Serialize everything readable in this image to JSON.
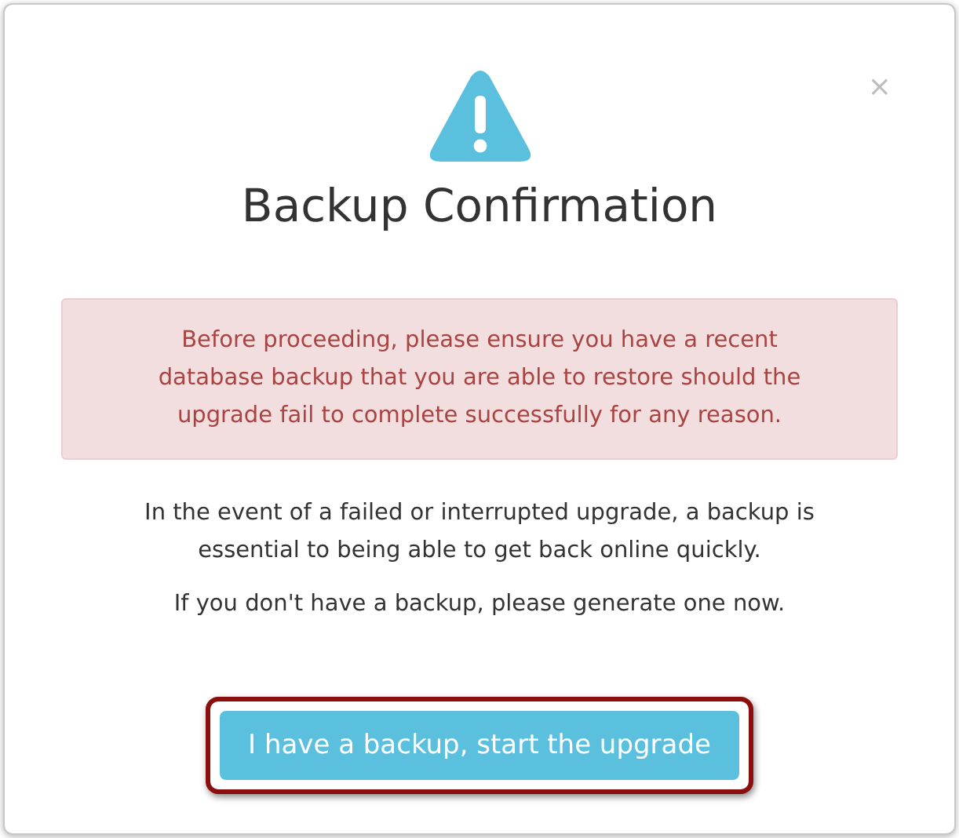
{
  "dialog": {
    "close": "×",
    "title": "Backup Confirmation",
    "alert": "Before proceeding, please ensure you have a recent database backup that you are able to restore should the upgrade fail to complete successfully for any reason.",
    "paragraphs": [
      "In the event of a failed or interrupted upgrade, a backup is essential to being able to get back online quickly.",
      "If you don't have a backup, please generate one now."
    ],
    "button": {
      "label": "I have a backup, start the upgrade",
      "highlighted": true
    }
  }
}
